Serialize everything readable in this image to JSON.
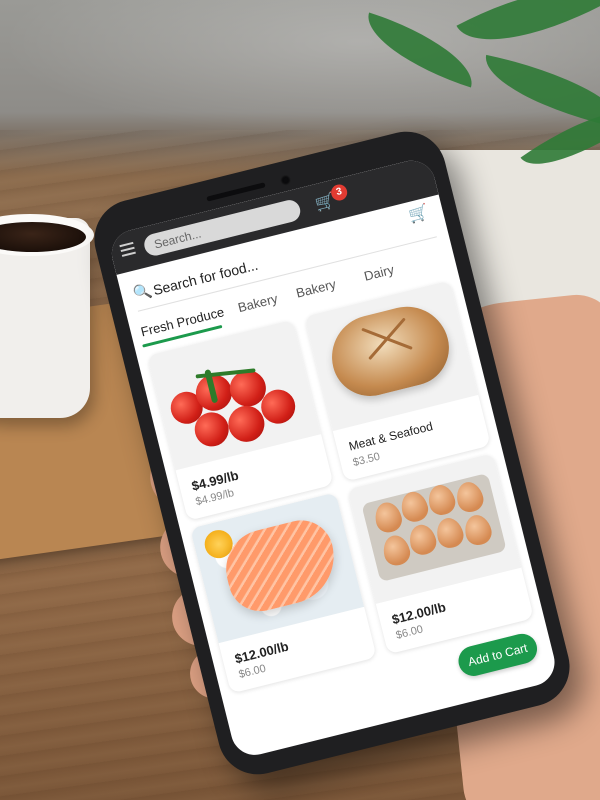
{
  "top_bar": {
    "search_placeholder": "Search...",
    "cart_badge": "3",
    "menu_icon": "hamburger-icon",
    "cart_icon": "cart-icon"
  },
  "search": {
    "placeholder": "Search for food..."
  },
  "tabs": [
    {
      "label": "Fresh Produce",
      "active": true
    },
    {
      "label": "Bakery",
      "active": false
    },
    {
      "label": "Bakery",
      "active": false
    },
    {
      "label": "Dairy",
      "active": false
    }
  ],
  "products": [
    {
      "image": "tomatoes",
      "price": "$4.99/lb",
      "subprice": "$4.99/lb"
    },
    {
      "image": "bread",
      "title": "Meat & Seafood",
      "subprice": "$3.50"
    },
    {
      "image": "salmon",
      "price": "$12.00/lb",
      "subprice": "$6.00"
    },
    {
      "image": "eggs",
      "price": "$12.00/lb",
      "subprice": "$6.00"
    }
  ],
  "cta": {
    "label": "Add to Cart"
  },
  "colors": {
    "accent": "#1c9a4c",
    "badge": "#e23b32"
  }
}
